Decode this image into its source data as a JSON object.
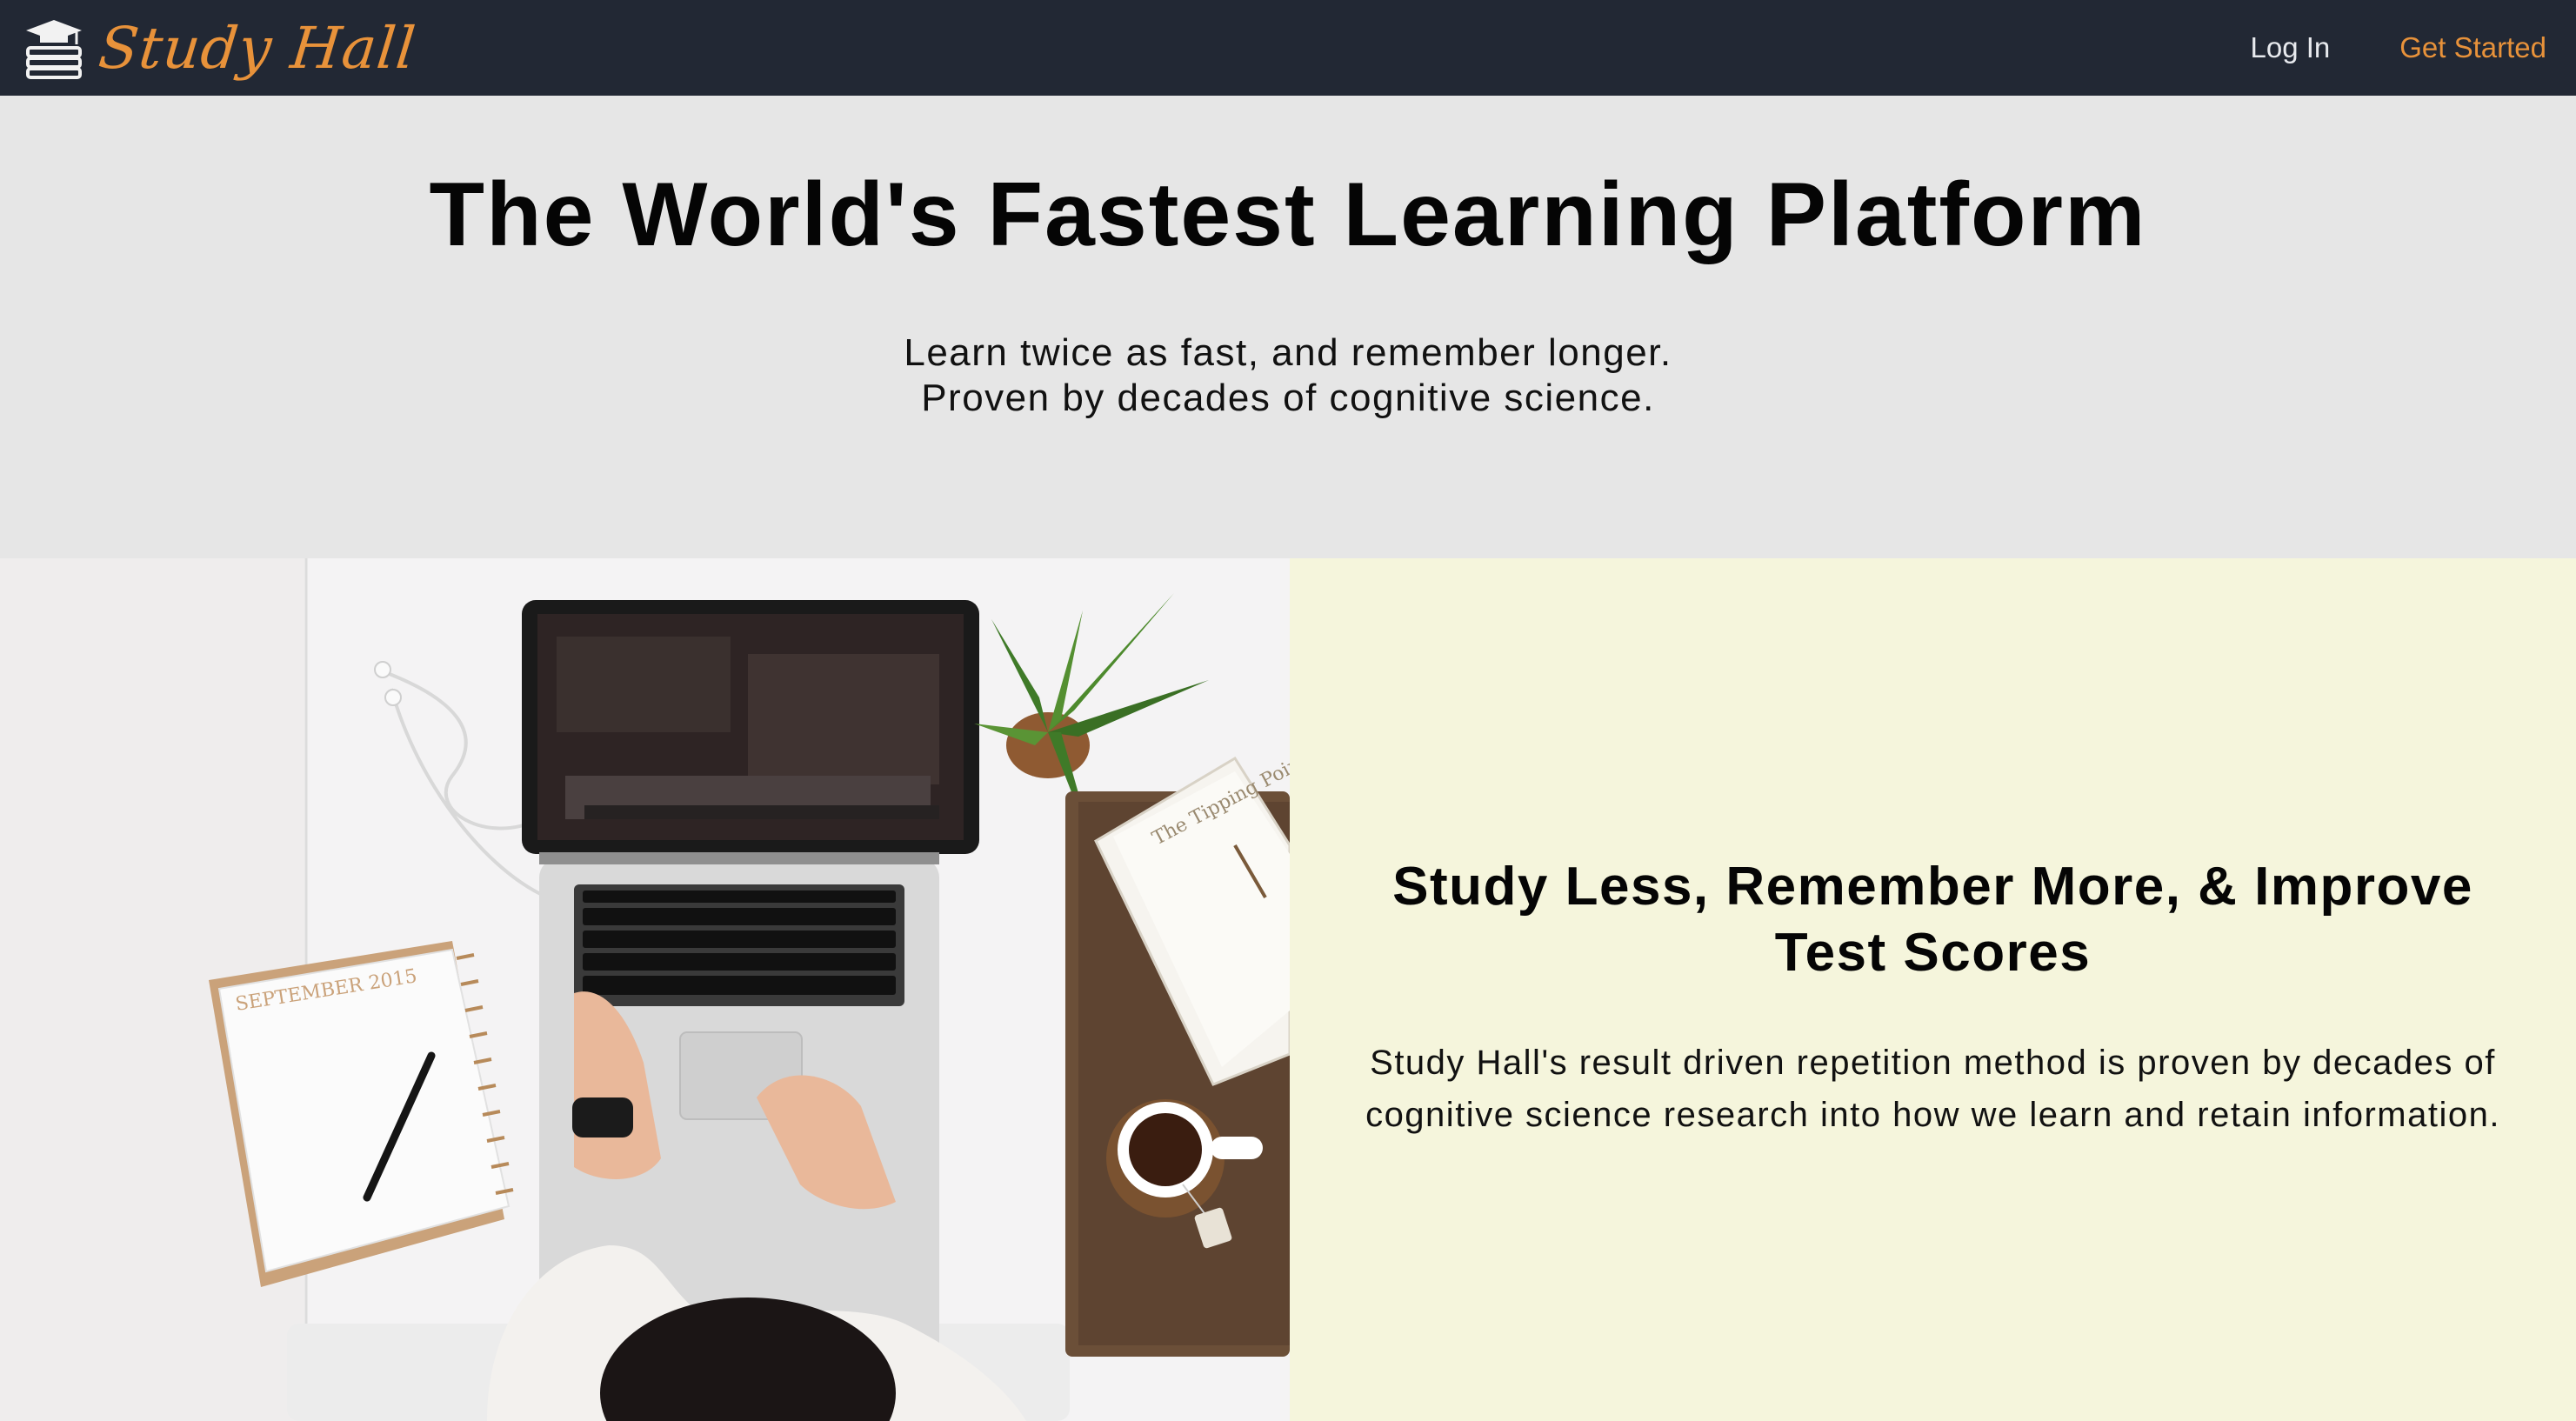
{
  "navbar": {
    "brand_icon": "graduation-cap-books-icon",
    "brand_name": "Study Hall",
    "login_label": "Log In",
    "cta_label": "Get Started",
    "colors": {
      "background": "#222834",
      "accent": "#e8923a",
      "link": "#e8eaee"
    }
  },
  "hero": {
    "title": "The World's Fastest Learning Platform",
    "subtitle_line1": "Learn twice as fast, and remember longer.",
    "subtitle_line2": "Proven by decades of cognitive science."
  },
  "feature": {
    "image_subject": "student-desk-laptop-photo",
    "calendar_label": "SEPTEMBER 2015",
    "book_title": "The Tipping Point",
    "title": "Study Less, Remember More, & Improve Test Scores",
    "text": "Study Hall's result driven repetition method is proven by decades of cognitive science research into how we learn and retain information.",
    "colors": {
      "panel": "#f5f5dc",
      "hero": "#e6e6e6"
    }
  }
}
